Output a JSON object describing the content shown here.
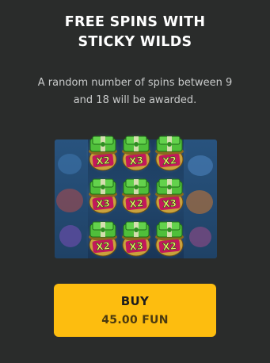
{
  "feature": {
    "title_line1": "FREE SPINS WITH",
    "title_line2": "STICKY WILDS",
    "description_line1": "A random number of spins between 9",
    "description_line2": "and 18 will be awarded."
  },
  "preview": {
    "wilds": [
      {
        "row": 0,
        "col": 0,
        "multiplier": "X2"
      },
      {
        "row": 0,
        "col": 1,
        "multiplier": "X3"
      },
      {
        "row": 0,
        "col": 2,
        "multiplier": "X2"
      },
      {
        "row": 1,
        "col": 0,
        "multiplier": "X3"
      },
      {
        "row": 1,
        "col": 1,
        "multiplier": "X2"
      },
      {
        "row": 1,
        "col": 2,
        "multiplier": "X3"
      },
      {
        "row": 2,
        "col": 0,
        "multiplier": "X2"
      },
      {
        "row": 2,
        "col": 1,
        "multiplier": "X3"
      },
      {
        "row": 2,
        "col": 2,
        "multiplier": "X2"
      }
    ]
  },
  "buy_button": {
    "label": "BUY",
    "price": "45.00 FUN"
  },
  "colors": {
    "background": "#2a2c2b",
    "button": "#fdbd0f",
    "cash_green": "#4fbf3a",
    "pot": "#c9a23c",
    "multiplier_badge": "#c2185b",
    "multiplier_text": "#e8f26a"
  }
}
